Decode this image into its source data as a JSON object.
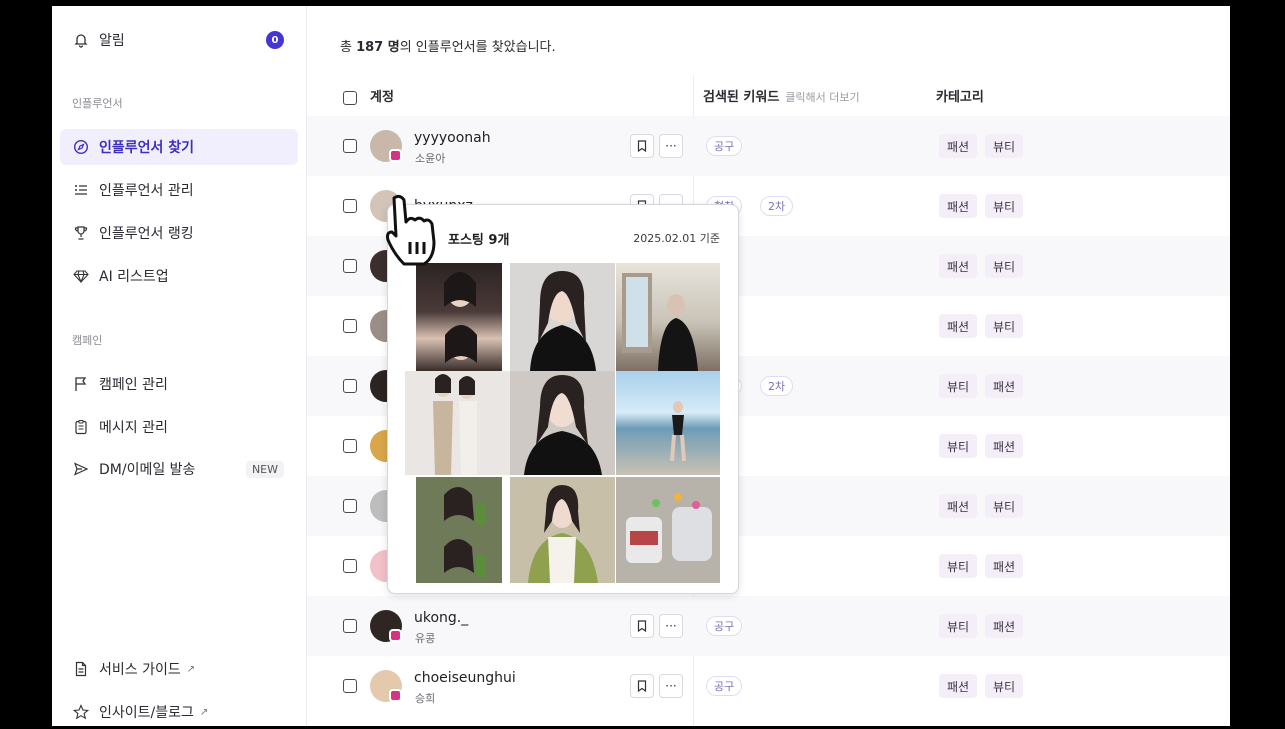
{
  "sidebar": {
    "notifications": {
      "label": "알림",
      "count": "0"
    },
    "section_influencer": "인플루언서",
    "items_influencer": [
      {
        "label": "인플루언서 찾기",
        "icon": "compass-icon",
        "active": true
      },
      {
        "label": "인플루언서 관리",
        "icon": "list-icon",
        "active": false
      },
      {
        "label": "인플루언서 랭킹",
        "icon": "trophy-icon",
        "active": false
      },
      {
        "label": "AI 리스트업",
        "icon": "diamond-icon",
        "active": false
      }
    ],
    "section_campaign": "캠페인",
    "items_campaign": [
      {
        "label": "캠페인 관리",
        "icon": "flag-icon"
      },
      {
        "label": "메시지 관리",
        "icon": "clipboard-icon"
      },
      {
        "label": "DM/이메일 발송",
        "icon": "send-icon",
        "badge": "NEW"
      }
    ],
    "footer": [
      {
        "label": "서비스 가이드",
        "icon": "document-icon"
      },
      {
        "label": "인사이트/블로그",
        "icon": "star-icon"
      }
    ]
  },
  "main": {
    "summary_prefix": "총 ",
    "summary_count": "187 명",
    "summary_suffix": "의 인플루언서를 찾았습니다.",
    "headers": {
      "account": "계정",
      "keywords": "검색된 키워드",
      "keywords_hint": "클릭해서 더보기",
      "category": "카테고리"
    },
    "rows": [
      {
        "handle": "yyyyoonah",
        "name": "소윤아",
        "keywords": [
          "공구"
        ],
        "categories": [
          "패션",
          "뷰티"
        ]
      },
      {
        "handle": "hyxunxz",
        "name": "",
        "keywords": [
          "협찬",
          "2차"
        ],
        "categories": [
          "패션",
          "뷰티"
        ]
      },
      {
        "handle": "",
        "name": "",
        "keywords": [],
        "categories": [
          "패션",
          "뷰티"
        ]
      },
      {
        "handle": "",
        "name": "",
        "keywords": [],
        "categories": [
          "패션",
          "뷰티"
        ]
      },
      {
        "handle": "",
        "name": "",
        "keywords": [
          "공구",
          "2차"
        ],
        "categories": [
          "뷰티",
          "패션"
        ]
      },
      {
        "handle": "",
        "name": "",
        "keywords": [],
        "categories": [
          "뷰티",
          "패션"
        ]
      },
      {
        "handle": "",
        "name": "",
        "keywords": [],
        "categories": [
          "패션",
          "뷰티"
        ]
      },
      {
        "handle": "",
        "name": "",
        "keywords": [],
        "categories": [
          "뷰티",
          "패션"
        ]
      },
      {
        "handle": "ukong._",
        "name": "유콩",
        "keywords": [
          "공구"
        ],
        "categories": [
          "뷰티",
          "패션"
        ]
      },
      {
        "handle": "choeiseunghui",
        "name": "승희",
        "keywords": [
          "공구"
        ],
        "categories": [
          "패션",
          "뷰티"
        ]
      }
    ]
  },
  "popup": {
    "title": "포스팅 9개",
    "date": "2025.02.01 기준"
  },
  "colors": {
    "accent": "#4534d6",
    "active_bg": "#f1effd",
    "chip_border": "#e1dcf4",
    "category_bg": "#f4eef9"
  }
}
